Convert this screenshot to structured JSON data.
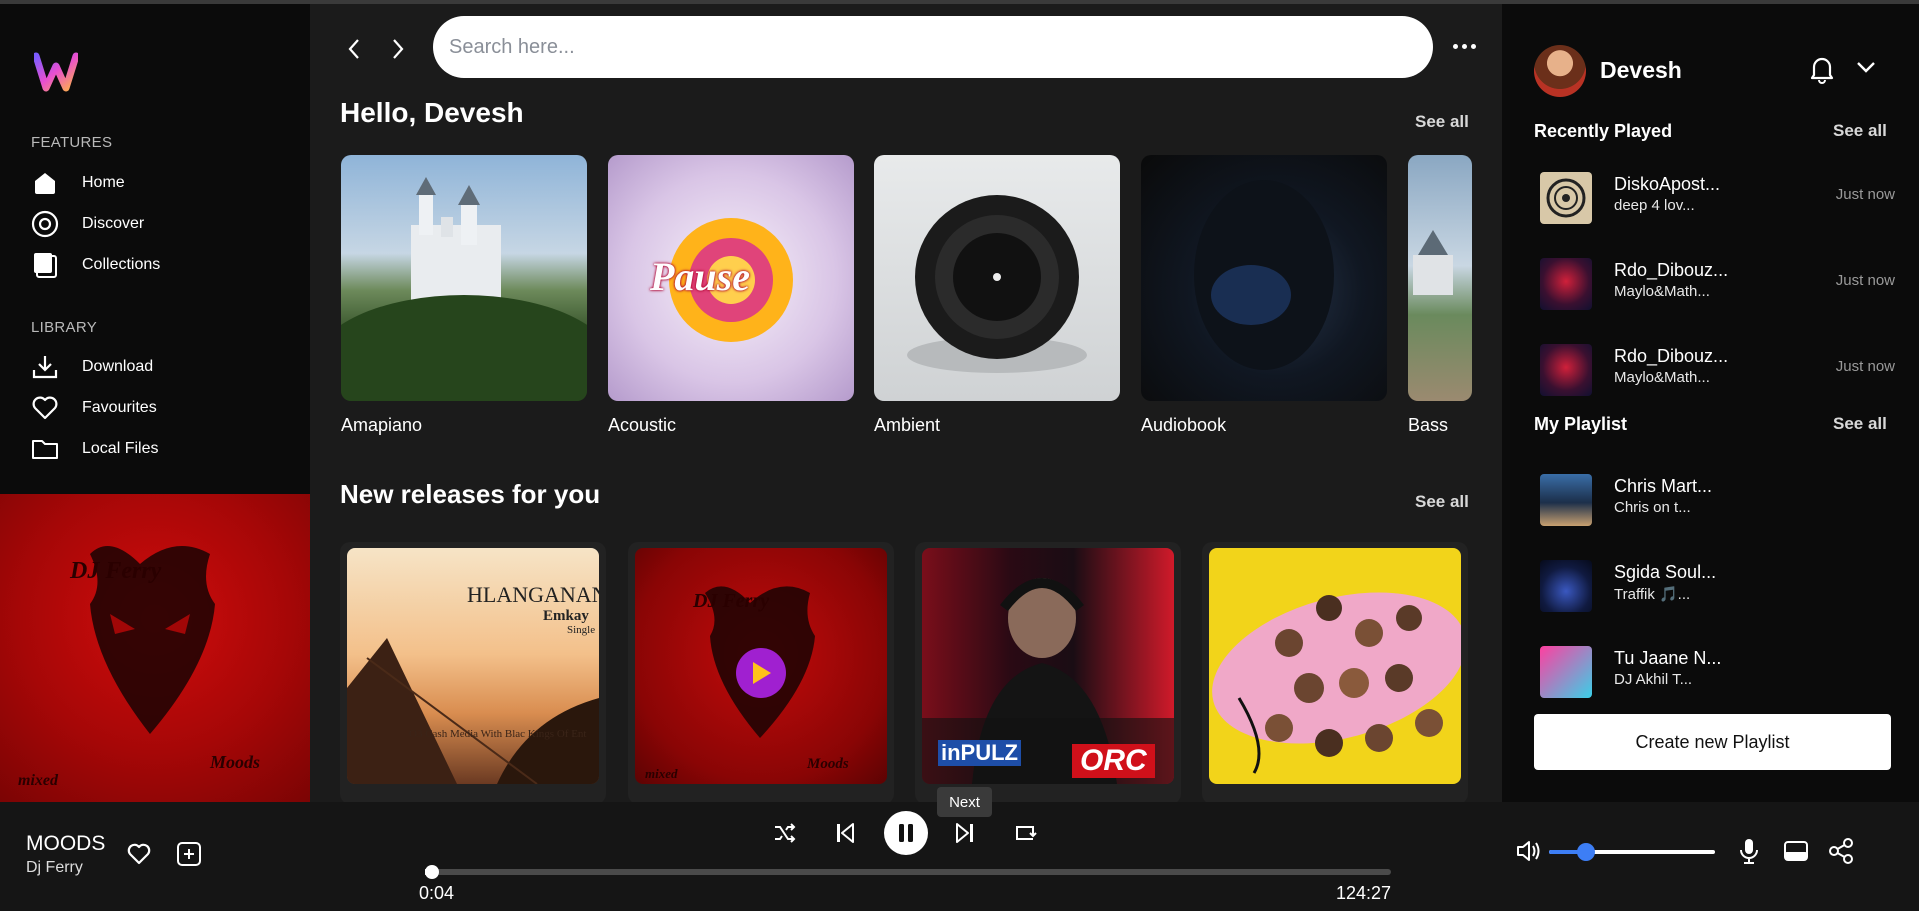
{
  "app": {
    "logo_letter": "W",
    "accent": "#c050e8"
  },
  "sidebar": {
    "features_title": "FEATURES",
    "features": [
      {
        "label": "Home",
        "icon": "home-icon"
      },
      {
        "label": "Discover",
        "icon": "compass-icon"
      },
      {
        "label": "Collections",
        "icon": "collections-icon"
      }
    ],
    "library_title": "LIBRARY",
    "library": [
      {
        "label": "Download",
        "icon": "download-icon"
      },
      {
        "label": "Favourites",
        "icon": "heart-icon"
      },
      {
        "label": "Local Files",
        "icon": "folder-icon"
      }
    ],
    "cover": {
      "line1": "DJ Ferry",
      "line2": "Moods",
      "line3": "mixed"
    }
  },
  "main": {
    "search_placeholder": "Search here...",
    "greeting": "Hello, Devesh",
    "greeting_see_all": "See all",
    "genres": [
      "Amapiano",
      "Acoustic",
      "Ambient",
      "Audiobook",
      "Bass"
    ],
    "new_releases_title": "New releases for you",
    "new_releases_see_all": "See all",
    "release1": {
      "title": "HLANGANANI",
      "artist": "Emkay",
      "kind": "Single",
      "caption": "O3 Cash Media With Blac Kings Of Ent"
    },
    "release2": {
      "line1": "DJ Ferry",
      "line2": "Moods",
      "line3": "mixed"
    },
    "release3": {
      "logo1": "inPULZ",
      "logo2": "ORC"
    }
  },
  "right": {
    "user_name": "Devesh",
    "recently_played_title": "Recently Played",
    "recently_see_all": "See all",
    "recent": [
      {
        "title": "DiskoApost...",
        "artist": "deep 4 lov...",
        "time": "Just now"
      },
      {
        "title": "Rdo_Dibouz...",
        "artist": "Maylo&Math...",
        "time": "Just now"
      },
      {
        "title": "Rdo_Dibouz...",
        "artist": "Maylo&Math...",
        "time": "Just now"
      }
    ],
    "playlist_title": "My Playlist",
    "playlist_see_all": "See all",
    "playlists": [
      {
        "title": "Chris Mart...",
        "artist": "Chris on t..."
      },
      {
        "title": "Sgida Soul...",
        "artist": "Traffik 🎵..."
      },
      {
        "title": "Tu Jaane N...",
        "artist": "DJ Akhil T..."
      }
    ],
    "create_playlist": "Create new Playlist"
  },
  "player": {
    "song": "MOODS",
    "artist": "Dj Ferry",
    "current_time": "0:04",
    "duration": "124:27",
    "progress": 0.0005,
    "volume": 0.22,
    "tooltip": "Next"
  }
}
